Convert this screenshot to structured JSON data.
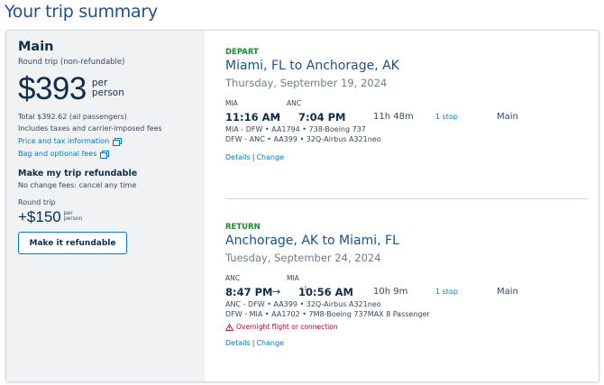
{
  "page": {
    "title": "Your trip summary"
  },
  "summary": {
    "cabin": "Main",
    "trip_type": "Round trip (non-refundable)",
    "price": "$393",
    "price_unit_1": "per",
    "price_unit_2": "person",
    "total": "Total $392.62 (all passengers)",
    "taxes_note": "Includes taxes and carrier-imposed fees",
    "price_tax_link": "Price and tax information",
    "bag_fees_link": "Bag and optional fees",
    "refund_title": "Make my trip refundable",
    "refund_note": "No change fees: cancel any time",
    "round_trip_label": "Round trip",
    "refund_price": "+$150",
    "refund_unit_1": "per",
    "refund_unit_2": "person",
    "refund_button": "Make it refundable"
  },
  "depart": {
    "label": "DEPART",
    "route": "Miami, FL to Anchorage, AK",
    "date": "Thursday, September 19, 2024",
    "origin_code": "MIA",
    "dest_code": "ANC",
    "depart_time": "11:16 AM",
    "arrow": "→",
    "arrive_time": "7:04 PM",
    "day_diff": "",
    "duration": "11h 48m",
    "stops": "1 stop",
    "cabin": "Main",
    "legs": [
      "MIA - DFW • AA1794 • 738-Boeing 737",
      "DFW - ANC • AA399 • 32Q-Airbus A321neo"
    ],
    "details_link": "Details",
    "separator": "|",
    "change_link": "Change"
  },
  "return": {
    "label": "RETURN",
    "route": "Anchorage, AK to Miami, FL",
    "date": "Tuesday, September 24, 2024",
    "origin_code": "ANC",
    "dest_code": "MIA",
    "depart_time": "8:47 PM",
    "arrow": "→",
    "arrive_time": "10:56 AM",
    "day_diff": "+1",
    "duration": "10h 9m",
    "stops": "1 stop",
    "cabin": "Main",
    "legs": [
      "ANC - DFW • AA399 • 32Q-Airbus A321neo",
      "DFW - MIA • AA1702 • 7M8-Boeing 737MAX 8 Passenger"
    ],
    "warning": "Overnight flight or connection",
    "details_link": "Details",
    "separator": "|",
    "change_link": "Change"
  },
  "colors": {
    "brand_blue": "#1d4f91",
    "link_blue": "#0078d2",
    "depart_green": "#1a8c2b",
    "warning_red": "#c30019",
    "panel_gray": "#f0f2f4"
  },
  "icons": {
    "external_link": "external-link-icon",
    "warning": "warning-triangle-icon"
  }
}
